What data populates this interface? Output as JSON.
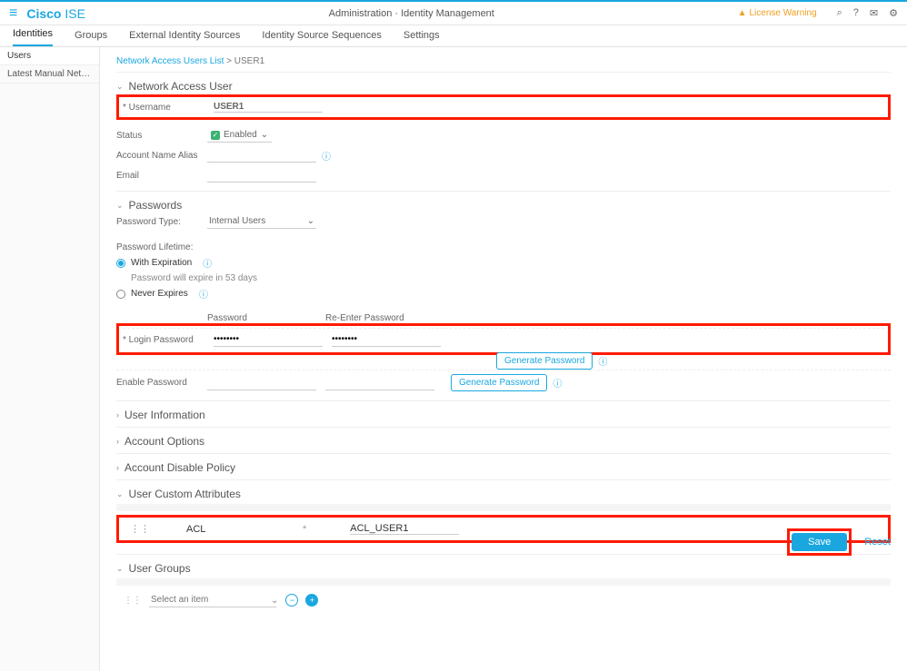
{
  "header": {
    "brand_bold": "Cisco",
    "brand_light": " ISE",
    "page_title": "Administration · Identity Management",
    "license_warning": "License Warning"
  },
  "tabs": [
    "Identities",
    "Groups",
    "External Identity Sources",
    "Identity Source Sequences",
    "Settings"
  ],
  "sidebar": {
    "items": [
      "Users",
      "Latest Manual Network Scan Res…"
    ]
  },
  "breadcrumb": {
    "parent": "Network Access Users List",
    "current": "USER1"
  },
  "sections": {
    "nau": {
      "title": "Network Access User"
    },
    "passwords": {
      "title": "Passwords"
    },
    "user_info": {
      "title": "User Information"
    },
    "acct_opts": {
      "title": "Account Options"
    },
    "acct_disable": {
      "title": "Account Disable Policy"
    },
    "custom_attr": {
      "title": "User Custom Attributes"
    },
    "user_groups": {
      "title": "User Groups"
    }
  },
  "form": {
    "username_label": "* Username",
    "username_value": "USER1",
    "status_label": "Status",
    "status_value": "Enabled",
    "alias_label": "Account Name Alias",
    "alias_value": "",
    "email_label": "Email",
    "email_value": ""
  },
  "passwords": {
    "type_label": "Password Type:",
    "type_value": "Internal Users",
    "lifetime_label": "Password Lifetime:",
    "with_exp": "With Expiration",
    "expire_note": "Password will expire in 53 days",
    "never": "Never Expires",
    "col_pwd": "Password",
    "col_re": "Re-Enter Password",
    "login_label": "* Login Password",
    "login_val": "········",
    "login_re": "········",
    "enable_label": "Enable Password",
    "gen": "Generate Password"
  },
  "attrs": {
    "name": "ACL",
    "value": "ACL_USER1"
  },
  "groups": {
    "placeholder": "Select an item"
  },
  "buttons": {
    "save": "Save",
    "reset": "Reset"
  }
}
